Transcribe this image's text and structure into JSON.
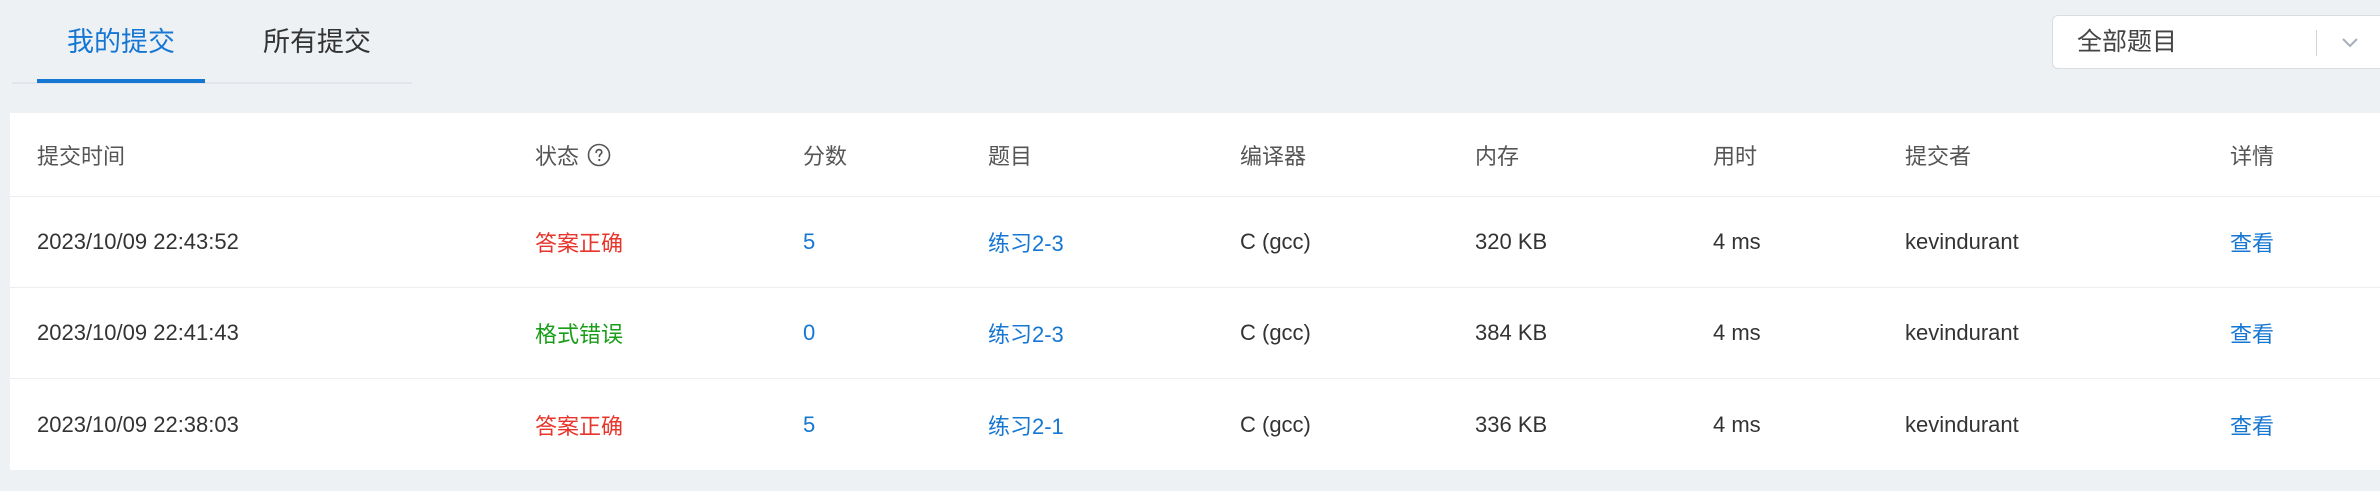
{
  "tabs": [
    {
      "label": "我的提交",
      "active": true
    },
    {
      "label": "所有提交",
      "active": false
    }
  ],
  "filter": {
    "selected": "全部题目",
    "chevron_icon": "chevron-down-icon"
  },
  "table": {
    "columns": {
      "time": "提交时间",
      "status": "状态",
      "score": "分数",
      "problem": "题目",
      "compiler": "编译器",
      "memory": "内存",
      "elapsed": "用时",
      "submitter": "提交者",
      "detail": "详情"
    },
    "rows": [
      {
        "time": "2023/10/09 22:43:52",
        "status": "答案正确",
        "status_color": "#e8352b",
        "score": "5",
        "problem": "练习2-3",
        "compiler": "C (gcc)",
        "memory": "320 KB",
        "elapsed": "4 ms",
        "submitter": "kevindurant",
        "detail": "查看"
      },
      {
        "time": "2023/10/09 22:41:43",
        "status": "格式错误",
        "status_color": "#1a9e1a",
        "score": "0",
        "problem": "练习2-3",
        "compiler": "C (gcc)",
        "memory": "384 KB",
        "elapsed": "4 ms",
        "submitter": "kevindurant",
        "detail": "查看"
      },
      {
        "time": "2023/10/09 22:38:03",
        "status": "答案正确",
        "status_color": "#e8352b",
        "score": "5",
        "problem": "练习2-1",
        "compiler": "C (gcc)",
        "memory": "336 KB",
        "elapsed": "4 ms",
        "submitter": "kevindurant",
        "detail": "查看"
      }
    ]
  },
  "colors": {
    "accent": "#1677d3",
    "correct": "#e8352b",
    "format_error": "#1a9e1a"
  }
}
